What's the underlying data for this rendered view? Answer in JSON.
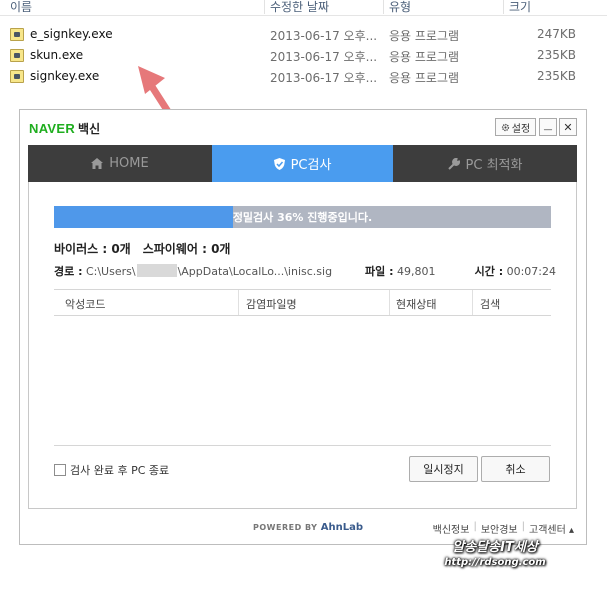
{
  "explorer": {
    "columns": {
      "name": "이름",
      "modified": "수정한 날짜",
      "type": "유형",
      "size": "크기"
    },
    "files": [
      {
        "name": "e_signkey.exe",
        "modified": "2013-06-17 오후...",
        "type": "응용 프로그램",
        "size": "247KB"
      },
      {
        "name": "skun.exe",
        "modified": "2013-06-17 오후...",
        "type": "응용 프로그램",
        "size": "235KB"
      },
      {
        "name": "signkey.exe",
        "modified": "2013-06-17 오후...",
        "type": "응용 프로그램",
        "size": "235KB"
      }
    ]
  },
  "window": {
    "brand": "NAVER",
    "app_name": "백신",
    "settings_label": "설정",
    "min_symbol": "—",
    "close_symbol": "✕"
  },
  "tabs": [
    {
      "label": "HOME",
      "icon": "home-icon"
    },
    {
      "label": "PC검사",
      "icon": "shield-check-icon",
      "active": true
    },
    {
      "label": "PC 최적화",
      "icon": "wrench-icon"
    }
  ],
  "scan": {
    "progress_text": "정밀검사 36% 진행중입니다.",
    "progress_percent": 36,
    "virus_label": "바이러스 : 0개",
    "spyware_label": "스파이웨어 : 0개",
    "path_label": "경로 :",
    "path_prefix": "C:\\Users\\",
    "path_suffix": "\\AppData\\LocalLo...\\inisc.sig",
    "files_label": "파일 :",
    "files_value": "49,801",
    "time_label": "시간 :",
    "time_value": "00:07:24"
  },
  "table": {
    "headers": [
      "악성코드",
      "감염파일명",
      "현재상태",
      "검색"
    ]
  },
  "controls": {
    "shutdown_label": "검사 완료 후 PC 종료",
    "pause_label": "일시정지",
    "cancel_label": "취소"
  },
  "footer": {
    "powered_by": "POWERED BY",
    "powered_brand": "AhnLab",
    "links": [
      "백신정보",
      "보안경보",
      "고객센터 ▴"
    ]
  },
  "watermark": {
    "line1": "알송달송IT세상",
    "line2": "http://rdsong.com"
  },
  "colors": {
    "accent": "#4a9cef",
    "brand_green": "#1fae1f",
    "tab_bar": "#3d3d3d",
    "progress_track": "#b0b6c2"
  }
}
